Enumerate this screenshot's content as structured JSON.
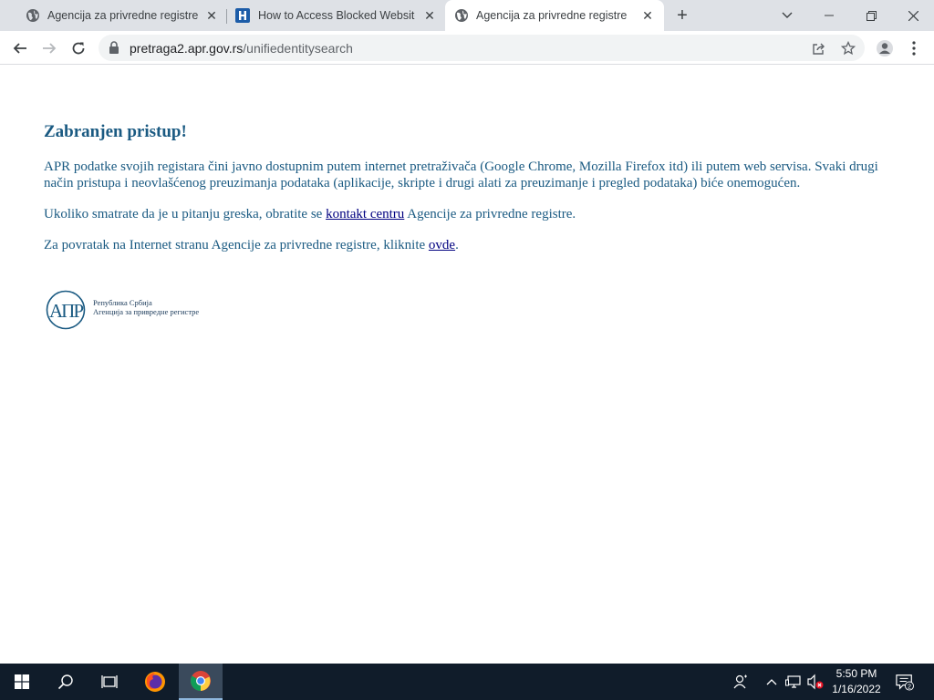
{
  "browser": {
    "tabs": [
      {
        "title": "Agencija za privredne registre",
        "icon": "globe-icon",
        "active": false
      },
      {
        "title": "How to Access Blocked Websites",
        "icon": "hotspot-shield-icon",
        "active": false
      },
      {
        "title": "Agencija za privredne registre",
        "icon": "globe-icon",
        "active": true
      }
    ],
    "new_tab_symbol": "+",
    "address": {
      "host": "pretraga2.apr.gov.rs",
      "path": "/unifiedentitysearch"
    }
  },
  "page": {
    "heading": "Zabranjen pristup!",
    "paragraph1": "APR podatke svojih registara čini javno dostupnim putem internet pretraživača (Google Chrome, Mozilla Firefox itd) ili putem web servisa. Svaki drugi način pristupa i neovlašćenog preuzimanja podataka (aplikacije, skripte i drugi alati za preuzimanje i pregled podataka) biće onemogućen.",
    "paragraph2": {
      "before": "Ukoliko smatrate da je u pitanju greska, obratite se ",
      "link": "kontakt centru",
      "after": " Agencije za privredne registre."
    },
    "paragraph3": {
      "before": "Za povratak na Internet stranu Agencije za privredne registre, kliknite ",
      "link": "ovde",
      "after": "."
    },
    "logo": {
      "monogram": "АПР",
      "line1": "Република Србија",
      "line2": "Агенција за привредне регистре"
    }
  },
  "taskbar": {
    "time": "5:50 PM",
    "date": "1/16/2022",
    "notification_count": "2"
  },
  "colors": {
    "page_text": "#1a5a82",
    "taskbar": "#101c2a",
    "tabstrip": "#dee1e6"
  }
}
